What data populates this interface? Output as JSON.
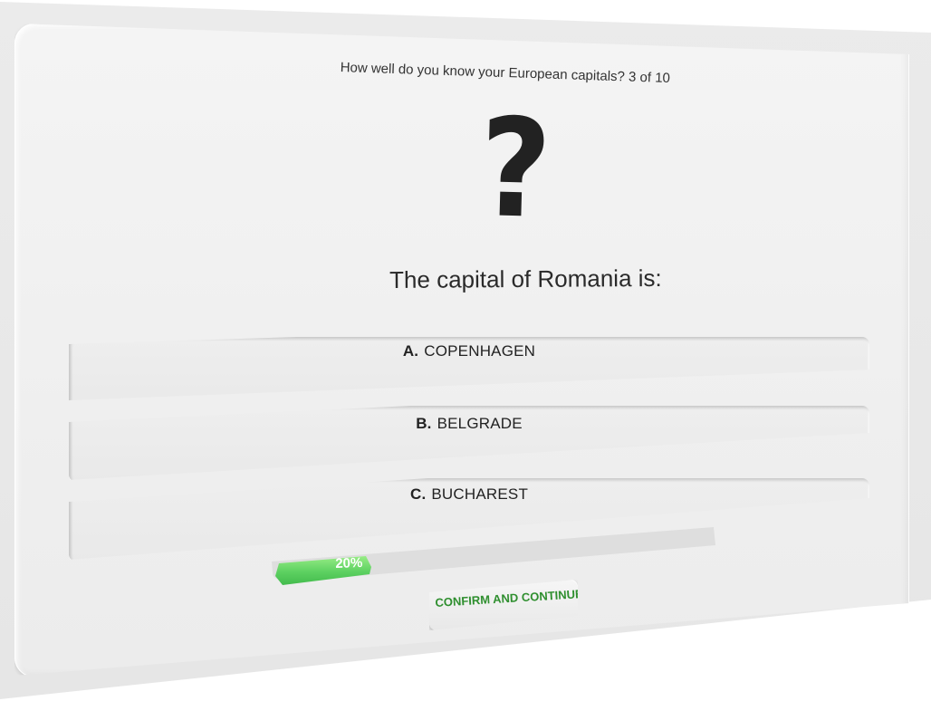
{
  "quiz": {
    "title": "How well do you know your European capitals? 3 of 10",
    "icon": "question-mark-icon",
    "question": "The capital of Romania is:"
  },
  "answers": [
    {
      "letter": "A.",
      "text": "COPENHAGEN"
    },
    {
      "letter": "B.",
      "text": "BELGRADE"
    },
    {
      "letter": "C.",
      "text": "BUCHAREST"
    }
  ],
  "progress": {
    "value": 0.2,
    "label": "20%",
    "color": "#5cd060"
  },
  "confirm": {
    "label": "CONFIRM AND CONTINUE",
    "color": "#2f8f2f"
  }
}
